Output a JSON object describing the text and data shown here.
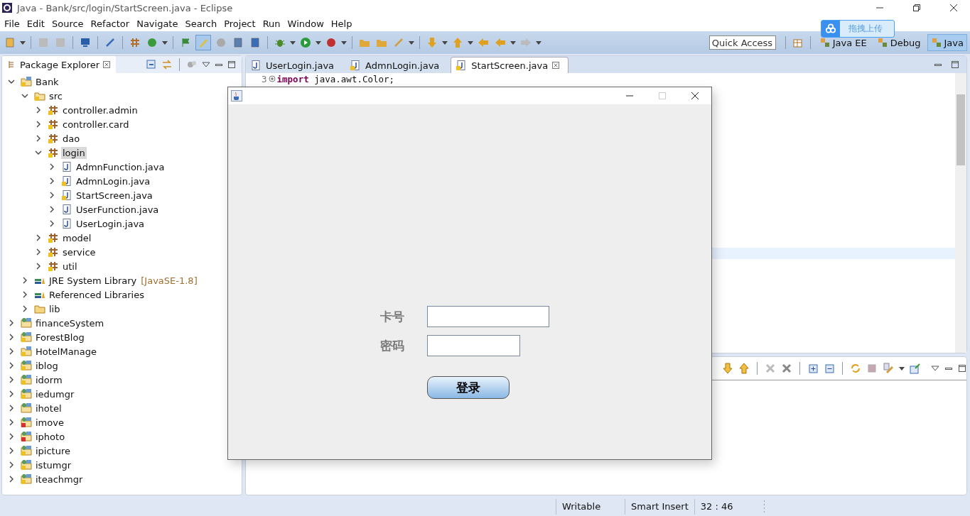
{
  "window": {
    "title": "Java - Bank/src/login/StartScreen.java - Eclipse"
  },
  "menu": [
    "File",
    "Edit",
    "Source",
    "Refactor",
    "Navigate",
    "Search",
    "Project",
    "Run",
    "Window",
    "Help"
  ],
  "toolbar": {
    "toggle_on": true,
    "quick_access": {
      "placeholder": "Quick Access"
    }
  },
  "perspectives": [
    {
      "label": "Java EE",
      "selected": false
    },
    {
      "label": "Debug",
      "selected": false
    },
    {
      "label": "Java",
      "selected": true
    }
  ],
  "upload_widget": {
    "label": "拖拽上传"
  },
  "explorer": {
    "title": "Package Explorer",
    "tree": [
      {
        "label": "Bank",
        "kind": "project",
        "warning": true,
        "error": false,
        "expanded": true,
        "selected": false,
        "children": [
          {
            "label": "src",
            "kind": "source",
            "warning": true,
            "error": false,
            "expanded": true,
            "selected": false,
            "children": [
              {
                "label": "controller.admin",
                "kind": "package",
                "warning": true,
                "error": false,
                "expanded": false,
                "selected": false
              },
              {
                "label": "controller.card",
                "kind": "package",
                "warning": true,
                "error": false,
                "expanded": false,
                "selected": false
              },
              {
                "label": "dao",
                "kind": "package",
                "warning": true,
                "error": false,
                "expanded": false,
                "selected": false
              },
              {
                "label": "login",
                "kind": "package",
                "warning": true,
                "error": false,
                "expanded": true,
                "selected": true,
                "children": [
                  {
                    "label": "AdmnFunction.java",
                    "kind": "file",
                    "warning": false,
                    "error": false,
                    "expanded": false,
                    "selected": false
                  },
                  {
                    "label": "AdmnLogin.java",
                    "kind": "file",
                    "warning": true,
                    "error": false,
                    "expanded": false,
                    "selected": false
                  },
                  {
                    "label": "StartScreen.java",
                    "kind": "file",
                    "warning": true,
                    "error": false,
                    "expanded": false,
                    "selected": false
                  },
                  {
                    "label": "UserFunction.java",
                    "kind": "file",
                    "warning": false,
                    "error": false,
                    "expanded": false,
                    "selected": false
                  },
                  {
                    "label": "UserLogin.java",
                    "kind": "file",
                    "warning": false,
                    "error": false,
                    "expanded": false,
                    "selected": false
                  }
                ]
              },
              {
                "label": "model",
                "kind": "package",
                "warning": true,
                "error": false,
                "expanded": false,
                "selected": false
              },
              {
                "label": "service",
                "kind": "package",
                "warning": true,
                "error": false,
                "expanded": false,
                "selected": false
              },
              {
                "label": "util",
                "kind": "package",
                "warning": true,
                "error": false,
                "expanded": false,
                "selected": false
              }
            ]
          },
          {
            "label": "JRE System Library",
            "decoration": "[JavaSE-1.8]",
            "kind": "library",
            "warning": false,
            "error": false,
            "expanded": false,
            "selected": false
          },
          {
            "label": "Referenced Libraries",
            "kind": "library",
            "warning": false,
            "error": false,
            "expanded": false,
            "selected": false
          },
          {
            "label": "lib",
            "kind": "folder",
            "warning": false,
            "error": false,
            "expanded": false,
            "selected": false
          }
        ]
      },
      {
        "label": "financeSystem",
        "kind": "web-project",
        "warning": false,
        "error": false,
        "expanded": false,
        "selected": false
      },
      {
        "label": "ForestBlog",
        "kind": "web-project",
        "warning": true,
        "error": false,
        "expanded": false,
        "selected": false
      },
      {
        "label": "HotelManage",
        "kind": "project",
        "warning": true,
        "error": false,
        "expanded": false,
        "selected": false
      },
      {
        "label": "iblog",
        "kind": "web-project",
        "warning": true,
        "error": false,
        "expanded": false,
        "selected": false
      },
      {
        "label": "idorm",
        "kind": "web-project",
        "warning": true,
        "error": false,
        "expanded": false,
        "selected": false
      },
      {
        "label": "iedumgr",
        "kind": "web-project",
        "warning": true,
        "error": false,
        "expanded": false,
        "selected": false
      },
      {
        "label": "ihotel",
        "kind": "web-project",
        "warning": false,
        "error": false,
        "expanded": false,
        "selected": false
      },
      {
        "label": "imove",
        "kind": "web-project",
        "warning": false,
        "error": true,
        "expanded": false,
        "selected": false
      },
      {
        "label": "iphoto",
        "kind": "web-project",
        "warning": false,
        "error": true,
        "expanded": false,
        "selected": false
      },
      {
        "label": "ipicture",
        "kind": "web-project",
        "warning": true,
        "error": false,
        "expanded": false,
        "selected": false
      },
      {
        "label": "istumgr",
        "kind": "web-project",
        "warning": true,
        "error": false,
        "expanded": false,
        "selected": false
      },
      {
        "label": "iteachmgr",
        "kind": "web-project",
        "warning": true,
        "error": false,
        "expanded": false,
        "selected": false
      }
    ]
  },
  "editor": {
    "tabs": [
      {
        "label": "UserLogin.java",
        "warning": false,
        "selected": false
      },
      {
        "label": "AdmnLogin.java",
        "warning": true,
        "selected": false
      },
      {
        "label": "StartScreen.java",
        "warning": true,
        "selected": true
      }
    ],
    "lines": [
      {
        "number": "3",
        "code": "**import** java.awt.Color;"
      }
    ]
  },
  "dialog": {
    "fields": [
      {
        "label": "卡号",
        "kind": "wide"
      },
      {
        "label": "密码",
        "kind": "narrow"
      }
    ],
    "button": "登录"
  },
  "status_bar": [
    "Writable",
    "Smart Insert",
    "32 : 46"
  ]
}
